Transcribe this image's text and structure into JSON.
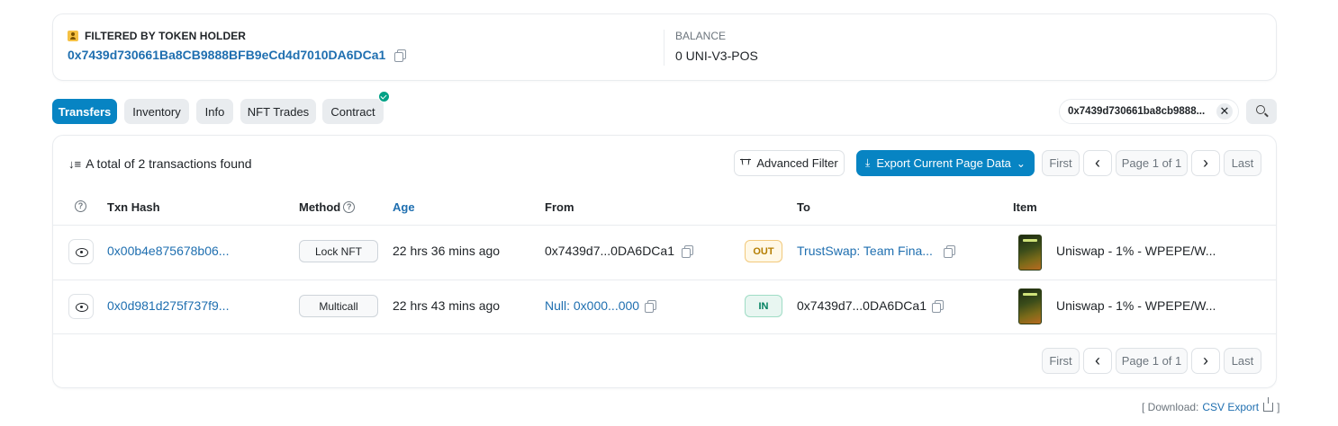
{
  "filter": {
    "label": "FILTERED BY TOKEN HOLDER",
    "address": "0x7439d730661Ba8CB9888BFB9eCd4d7010DA6DCa1",
    "balance_label": "BALANCE",
    "balance_value": "0 UNI-V3-POS"
  },
  "tabs": [
    {
      "label": "Transfers"
    },
    {
      "label": "Inventory"
    },
    {
      "label": "Info"
    },
    {
      "label": "NFT Trades"
    },
    {
      "label": "Contract"
    }
  ],
  "search": {
    "chip_text": "0x7439d730661ba8cb9888...",
    "clear_glyph": "✕"
  },
  "summary": {
    "text": "A total of 2 transactions found",
    "sort_glyph": "↓≡"
  },
  "toolbar": {
    "advanced_filter": "Advanced Filter",
    "export": "Export Current Page Data",
    "export_arrow": "⌄",
    "download_glyph": "⤓"
  },
  "pagination": {
    "first": "First",
    "prev": "‹",
    "page": "Page 1 of 1",
    "next": "›",
    "last": "Last"
  },
  "table": {
    "headers": {
      "help": "?",
      "txn_hash": "Txn Hash",
      "method": "Method",
      "age": "Age",
      "from": "From",
      "to": "To",
      "item": "Item"
    },
    "rows": [
      {
        "txn_hash": "0x00b4e875678b06...",
        "method": "Lock NFT",
        "age": "22 hrs 36 mins ago",
        "from": "0x7439d7...0DA6DCa1",
        "direction": "OUT",
        "to": "TrustSwap: Team Fina...",
        "item": "Uniswap - 1% - WPEPE/W..."
      },
      {
        "txn_hash": "0x0d981d275f737f9...",
        "method": "Multicall",
        "age": "22 hrs 43 mins ago",
        "from": "Null: 0x000...000",
        "direction": "IN",
        "to": "0x7439d7...0DA6DCa1",
        "item": "Uniswap - 1% - WPEPE/W..."
      }
    ]
  },
  "footer": {
    "prefix": "[ Download:",
    "link": "CSV Export",
    "suffix": "]"
  },
  "colors": {
    "accent": "#0784c3",
    "link": "#1f6fb0",
    "out": "#b47d00",
    "in": "#00805f",
    "verified": "#00a186"
  }
}
